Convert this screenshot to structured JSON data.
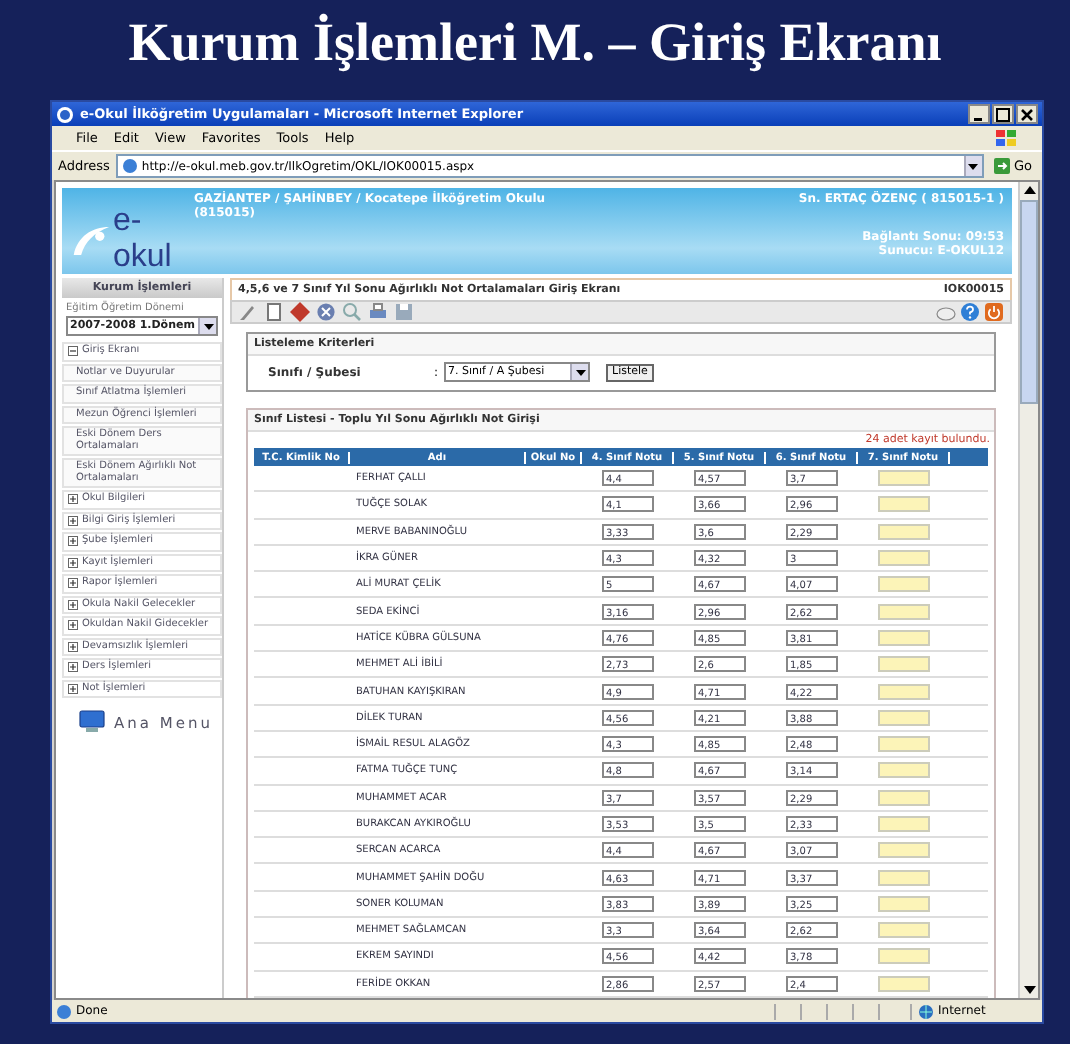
{
  "slide": {
    "title": "Kurum İşlemleri M. – Giriş Ekranı"
  },
  "window": {
    "title": "e-Okul İlköğretim Uygulamaları - Microsoft Internet Explorer"
  },
  "menu": [
    "File",
    "Edit",
    "View",
    "Favorites",
    "Tools",
    "Help"
  ],
  "address": {
    "label": "Address",
    "url": "http://e-okul.meb.gov.tr/IlkOgretim/OKL/IOK00015.aspx",
    "go": "Go"
  },
  "header": {
    "logo": "e-okul",
    "school": "GAZİANTEP / ŞAHİNBEY / Kocatepe İlköğretim Okulu",
    "code": "(815015)",
    "user": "Sn. ERTAÇ ÖZENÇ ( 815015-1 )",
    "session": "Bağlantı Sonu: 09:53",
    "server": "Sunucu: E-OKUL12"
  },
  "sidebar": {
    "title": "Kurum İşlemleri",
    "period_label": "Eğitim Öğretim Dönemi",
    "period": "2007-2008 1.Dönem",
    "items": [
      {
        "label": "Giriş Ekranı",
        "expanded": true,
        "children": [
          {
            "label": "Notlar ve Duyurular"
          },
          {
            "label": "Sınıf Atlatma İşlemleri"
          },
          {
            "label": "Mezun Öğrenci İşlemleri"
          },
          {
            "label": "Eski Dönem Ders Ortalamaları"
          },
          {
            "label": "Eski Dönem Ağırlıklı Not Ortalamaları"
          }
        ]
      },
      {
        "label": "Okul Bilgileri",
        "expanded": false
      },
      {
        "label": "Bilgi Giriş İşlemleri",
        "expanded": false
      },
      {
        "label": "Şube İşlemleri",
        "expanded": false
      },
      {
        "label": "Kayıt İşlemleri",
        "expanded": false
      },
      {
        "label": "Rapor İşlemleri",
        "expanded": false
      },
      {
        "label": "Okula Nakil Gelecekler",
        "expanded": false
      },
      {
        "label": "Okuldan Nakil Gidecekler",
        "expanded": false
      },
      {
        "label": "Devamsızlık İşlemleri",
        "expanded": false
      },
      {
        "label": "Ders İşlemleri",
        "expanded": false
      },
      {
        "label": "Not İşlemleri",
        "expanded": false
      }
    ],
    "home": "Ana Menu"
  },
  "page": {
    "title": "4,5,6 ve 7 Sınıf Yıl Sonu Ağırlıklı Not Ortalamaları Giriş Ekranı",
    "code": "IOK00015"
  },
  "criteria": {
    "title": "Listeleme Kriterleri",
    "label": "Sınıfı / Şubesi",
    "colon": ":",
    "value": "7. Sınıf / A Şubesi",
    "button": "Listele"
  },
  "list": {
    "title": "Sınıf Listesi - Toplu Yıl Sonu Ağırlıklı Not Girişi",
    "count": "24 adet kayıt bulundu.",
    "columns": [
      "T.C. Kimlik No",
      "Adı",
      "Okul No",
      "4. Sınıf Notu",
      "5. Sınıf Notu",
      "6. Sınıf Notu",
      "7. Sınıf Notu"
    ],
    "rows": [
      {
        "name": "FERHAT ÇALLI",
        "grades": [
          "4,4",
          "4,57",
          "3,7"
        ]
      },
      {
        "name": "TUĞÇE SOLAK",
        "grades": [
          "4,1",
          "3,66",
          "2,96"
        ]
      },
      {
        "name": "MERVE BABANINOĞLU",
        "grades": [
          "3,33",
          "3,6",
          "2,29"
        ]
      },
      {
        "name": "İKRA GÜNER",
        "grades": [
          "4,3",
          "4,32",
          "3"
        ]
      },
      {
        "name": "ALİ MURAT ÇELİK",
        "grades": [
          "5",
          "4,67",
          "4,07"
        ]
      },
      {
        "name": "SEDA EKİNCİ",
        "grades": [
          "3,16",
          "2,96",
          "2,62"
        ]
      },
      {
        "name": "HATİCE KÜBRA GÜLSUNA",
        "grades": [
          "4,76",
          "4,85",
          "3,81"
        ]
      },
      {
        "name": "MEHMET ALİ İBİLİ",
        "grades": [
          "2,73",
          "2,6",
          "1,85"
        ]
      },
      {
        "name": "BATUHAN KAYIŞKIRAN",
        "grades": [
          "4,9",
          "4,71",
          "4,22"
        ]
      },
      {
        "name": "DİLEK TURAN",
        "grades": [
          "4,56",
          "4,21",
          "3,88"
        ]
      },
      {
        "name": "İSMAİL RESUL ALAGÖZ",
        "grades": [
          "4,3",
          "4,85",
          "2,48"
        ]
      },
      {
        "name": "FATMA TUĞÇE TUNÇ",
        "grades": [
          "4,8",
          "4,67",
          "3,14"
        ]
      },
      {
        "name": "MUHAMMET ACAR",
        "grades": [
          "3,7",
          "3,57",
          "2,29"
        ]
      },
      {
        "name": "BURAKCAN AYKIROĞLU",
        "grades": [
          "3,53",
          "3,5",
          "2,33"
        ]
      },
      {
        "name": "SERCAN ACARCA",
        "grades": [
          "4,4",
          "4,67",
          "3,07"
        ]
      },
      {
        "name": "MUHAMMET ŞAHİN DOĞU",
        "grades": [
          "4,63",
          "4,71",
          "3,37"
        ]
      },
      {
        "name": "SONER KOLUMAN",
        "grades": [
          "3,83",
          "3,89",
          "3,25"
        ]
      },
      {
        "name": "MEHMET SAĞLAMCAN",
        "grades": [
          "3,3",
          "3,64",
          "2,62"
        ]
      },
      {
        "name": "EKREM SAYINDI",
        "grades": [
          "4,56",
          "4,42",
          "3,78"
        ]
      },
      {
        "name": "FERİDE OKKAN",
        "grades": [
          "2,86",
          "2,57",
          "2,4"
        ]
      }
    ]
  },
  "status_bar": {
    "text": "Done",
    "zone": "Internet"
  }
}
